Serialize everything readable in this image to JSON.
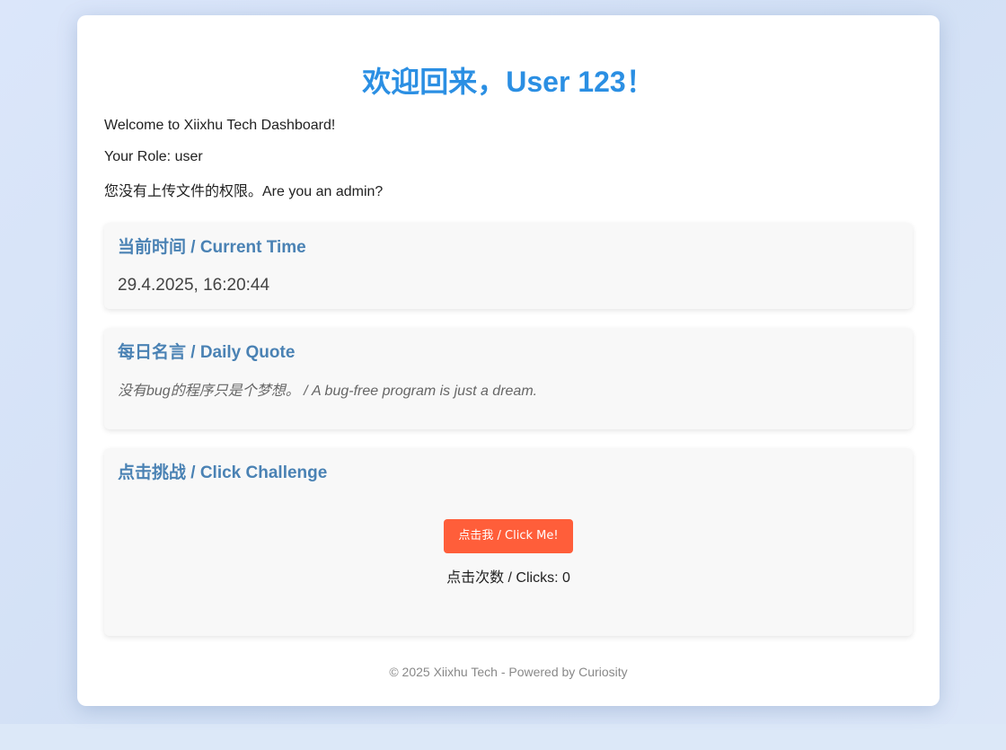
{
  "header": {
    "title": "欢迎回来，User 123！"
  },
  "info": {
    "welcome": "Welcome to Xiixhu Tech Dashboard!",
    "role": "Your Role: user",
    "permission": "您没有上传文件的权限。Are you an admin?"
  },
  "time_panel": {
    "title": "当前时间 / Current Time",
    "value": "29.4.2025, 16:20:44"
  },
  "quote_panel": {
    "title": "每日名言 / Daily Quote",
    "quote": "没有bug的程序只是个梦想。 / A bug-free program is just a dream."
  },
  "click_panel": {
    "title": "点击挑战 / Click Challenge",
    "button_label": "点击我 / Click Me!",
    "clicks_text": "点击次数 / Clicks: 0"
  },
  "footer": {
    "text": "© 2025 Xiixhu Tech - Powered by Curiosity"
  },
  "colors": {
    "title": "#2b8fe3",
    "panel_title": "#4a82b4",
    "button": "#ff5e3a",
    "background": "#dce8f8"
  }
}
